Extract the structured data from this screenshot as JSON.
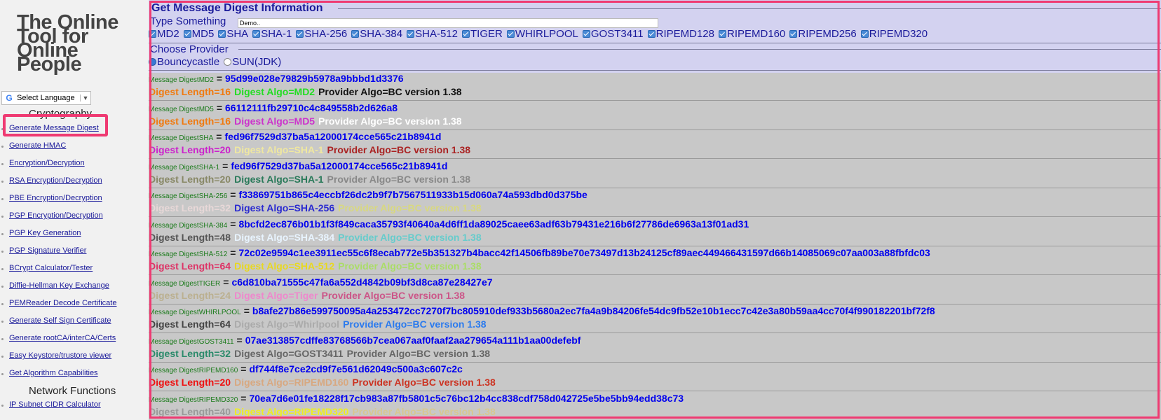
{
  "sidebar": {
    "logo_lines": [
      "The Online",
      "Tool for",
      "Online",
      "People"
    ],
    "language_label": "Select Language",
    "sections": {
      "cryptography": "Cryptography",
      "network": "Network Functions"
    },
    "links": [
      "Generate Message Digest",
      "Generate HMAC",
      "Encryption/Decryption",
      "RSA Encryption/Decryption",
      "PBE Encryption/Decryption",
      "PGP Encryption/Decryption",
      "PGP Key Generation",
      "PGP Signature Verifier",
      "BCrypt Calculator/Tester",
      "Diffie-Hellman Key Exchange",
      "PEMReader Decode Certificate",
      "Generate Self Sign Certificate",
      "Generate rootCA/interCA/Certs",
      "Easy Keystore/trustore viewer",
      "Get Algorithm Capabilities"
    ],
    "network_links": [
      "IP Subnet CIDR Calculator"
    ]
  },
  "form": {
    "title": "Get Message Digest Information",
    "type_label": "Type Something",
    "input_value": "Demo..",
    "algorithms": [
      "MD2",
      "MD5",
      "SHA",
      "SHA-1",
      "SHA-256",
      "SHA-384",
      "SHA-512",
      "TIGER",
      "WHIRLPOOL",
      "GOST3411",
      "RIPEMD128",
      "RIPEMD160",
      "RIPEMD256",
      "RIPEMD320"
    ],
    "provider_label": "Choose Provider",
    "providers": [
      {
        "label": "Bouncycastle",
        "selected": true
      },
      {
        "label": "SUN(JDK)",
        "selected": false
      }
    ]
  },
  "results": [
    {
      "algo": "MD2",
      "hash": "95d99e028e79829b5978a9bbbd1d3376",
      "length": "Digest Length=16",
      "algo_text": "Digest Algo=MD2",
      "provider": "Provider Algo=BC version 1.38",
      "colors": [
        "#f07a10",
        "#22dd22",
        "#111111"
      ]
    },
    {
      "algo": "MD5",
      "hash": "66112111fb29710c4c849558b2d626a8",
      "length": "Digest Length=16",
      "algo_text": "Digest Algo=MD5",
      "provider": "Provider Algo=BC version 1.38",
      "colors": [
        "#f07a10",
        "#cc33cc",
        "#ffffff"
      ]
    },
    {
      "algo": "SHA",
      "hash": "fed96f7529d37ba5a12000174cce565c21b8941d",
      "length": "Digest Length=20",
      "algo_text": "Digest Algo=SHA-1",
      "provider": "Provider Algo=BC version 1.38",
      "colors": [
        "#cc22cc",
        "#f0e8a0",
        "#aa2222"
      ]
    },
    {
      "algo": "SHA-1",
      "hash": "fed96f7529d37ba5a12000174cce565c21b8941d",
      "length": "Digest Length=20",
      "algo_text": "Digest Algo=SHA-1",
      "provider": "Provider Algo=BC version 1.38",
      "colors": [
        "#888866",
        "#2a7a5a",
        "#888888"
      ]
    },
    {
      "algo": "SHA-256",
      "hash": "f33869751b865c4eccbf26dc2b9f7b7567511933b15d060a74a593dbd0d375be",
      "length": "Digest Length=32",
      "algo_text": "Digest Algo=SHA-256",
      "provider": "Provider Algo=BC version 1.38",
      "colors": [
        "#e8d8d8",
        "#2a2ad0",
        "#d8d880"
      ]
    },
    {
      "algo": "SHA-384",
      "hash": "8bcfd2ec876b01b1f3f849caca35793f40640a4d6ff1da89025caee63adf63b79431e216b6f27786de6963a13f01ad31",
      "length": "Digest Length=48",
      "algo_text": "Digest Algo=SHA-384",
      "provider": "Provider Algo=BC version 1.38",
      "colors": [
        "#555555",
        "#e8f4ff",
        "#66cccc"
      ]
    },
    {
      "algo": "SHA-512",
      "hash": "72c02e9594c1ee3911ec55c6f8ecab772e5b351327b4bacc42f14506fb89be70e73497d13b24125cf89aec449466431597d66b14085069c07aa003a88fbfdc03",
      "length": "Digest Length=64",
      "algo_text": "Digest Algo=SHA-512",
      "provider": "Provider Algo=BC version 1.38",
      "colors": [
        "#dd3366",
        "#e8d820",
        "#aadd66"
      ]
    },
    {
      "algo": "TIGER",
      "hash": "c6d810ba71555c47fa6a552d4842b09bf3d8ca87e28427e7",
      "length": "Digest Length=24",
      "algo_text": "Digest Algo=Tiger",
      "provider": "Provider Algo=BC version 1.38",
      "colors": [
        "#bbb090",
        "#ee88cc",
        "#cc5588"
      ]
    },
    {
      "algo": "WHIRLPOOL",
      "hash": "b8afe27b86e599750095a4a253472cc7270f7bc805910def933b5680a2ec7fa4a9b84206fe54dc9fb52e10b1ecc7c42e3a80b59aa4cc70f4f990182201bf72f8",
      "length": "Digest Length=64",
      "algo_text": "Digest Algo=Whirlpool",
      "provider": "Provider Algo=BC version 1.38",
      "colors": [
        "#444444",
        "#aaaaaa",
        "#2a7aee"
      ]
    },
    {
      "algo": "GOST3411",
      "hash": "07ae313857cdffe83768566b7cea067aaf0faaf2aa279654a111b1aa00defebf",
      "length": "Digest Length=32",
      "algo_text": "Digest Algo=GOST3411",
      "provider": "Provider Algo=BC version 1.38",
      "colors": [
        "#2a8a6a",
        "#666666",
        "#666666"
      ]
    },
    {
      "algo": "RIPEMD160",
      "hash": "df744f8e7ce2cd9f7e561d62049c500a3c607c2c",
      "length": "Digest Length=20",
      "algo_text": "Digest Algo=RIPEMD160",
      "provider": "Provider Algo=BC version 1.38",
      "colors": [
        "#ee1111",
        "#d8a880",
        "#cc3322"
      ]
    },
    {
      "algo": "RIPEMD320",
      "hash": "70ea7d6e01fe18228f17cb983a87fb5801c5c76bc12b4cc838cdf758d042725e5be5bb94edd38c73",
      "length": "Digest Length=40",
      "algo_text": "Digest Algo=RIPEMD320",
      "provider": "Provider Algo=BC version 1.38",
      "colors": [
        "#999999",
        "#eeee22",
        "#d8c890"
      ]
    }
  ],
  "result_prefix": "Message Digest"
}
